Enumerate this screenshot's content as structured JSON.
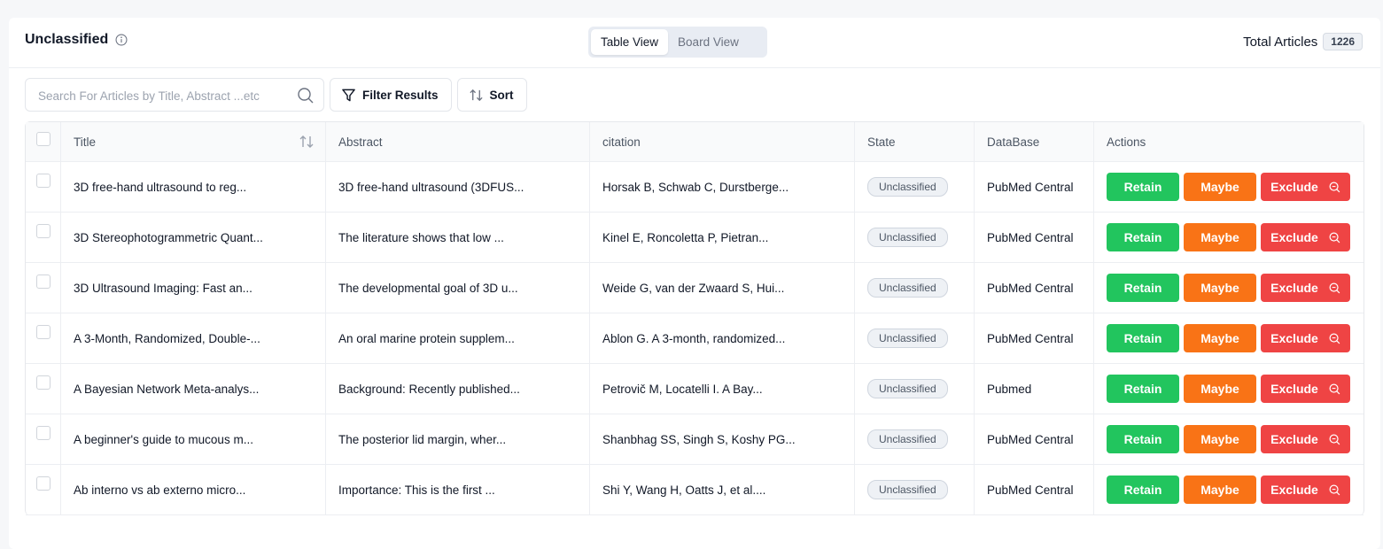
{
  "header": {
    "title": "Unclassified",
    "views": [
      "Table View",
      "Board View"
    ],
    "active_view": "Table View",
    "total_label": "Total Articles",
    "total_count": "1226"
  },
  "toolbar": {
    "search_placeholder": "Search For Articles by Title, Abstract ...etc",
    "filter_label": "Filter Results",
    "sort_label": "Sort"
  },
  "table": {
    "columns": [
      "Title",
      "Abstract",
      "citation",
      "State",
      "DataBase",
      "Actions"
    ],
    "actions": {
      "retain": "Retain",
      "maybe": "Maybe",
      "exclude": "Exclude"
    },
    "rows": [
      {
        "title": "3D free-hand ultrasound to reg...",
        "abstract": "3D free-hand ultrasound (3DFUS...",
        "citation": "Horsak B, Schwab C, Durstberge...",
        "state": "Unclassified",
        "database": "PubMed Central"
      },
      {
        "title": "3D Stereophotogrammetric Quant...",
        "abstract": "The literature shows that low ...",
        "citation": "Kinel E, Roncoletta P, Pietran...",
        "state": "Unclassified",
        "database": "PubMed Central"
      },
      {
        "title": "3D Ultrasound Imaging: Fast an...",
        "abstract": "The developmental goal of 3D u...",
        "citation": "Weide G, van der Zwaard S, Hui...",
        "state": "Unclassified",
        "database": "PubMed Central"
      },
      {
        "title": "A 3-Month, Randomized, Double-...",
        "abstract": "An oral marine protein supplem...",
        "citation": "Ablon G. A 3-month, randomized...",
        "state": "Unclassified",
        "database": "PubMed Central"
      },
      {
        "title": "A Bayesian Network Meta-analys...",
        "abstract": "Background: Recently published...",
        "citation": "Petrovič M, Locatelli I. A Bay...",
        "state": "Unclassified",
        "database": "Pubmed"
      },
      {
        "title": "A beginner's guide to mucous m...",
        "abstract": "The posterior lid margin, wher...",
        "citation": "Shanbhag SS, Singh S, Koshy PG...",
        "state": "Unclassified",
        "database": "PubMed Central"
      },
      {
        "title": "Ab interno vs ab externo micro...",
        "abstract": "Importance: This is the first ...",
        "citation": "Shi Y, Wang H, Oatts J, et al....",
        "state": "Unclassified",
        "database": "PubMed Central"
      }
    ]
  },
  "colors": {
    "retain": "#22c55e",
    "maybe": "#f97316",
    "exclude": "#ef4444"
  }
}
